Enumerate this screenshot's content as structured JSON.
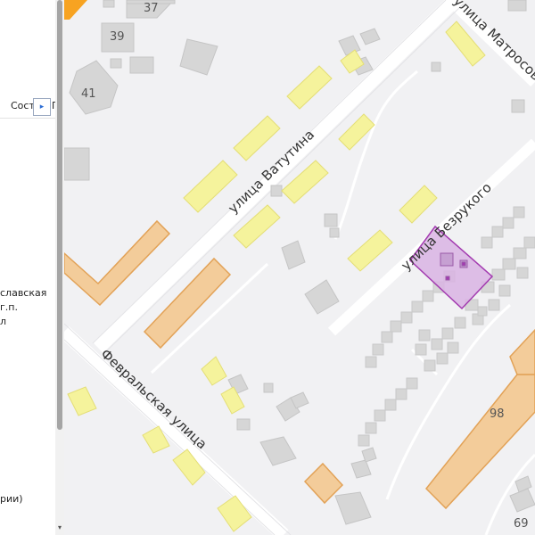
{
  "sidebar": {
    "tab_label": "Соста",
    "tab_cut": "Г",
    "collapse_arrow": "▸",
    "lines": [
      "славская",
      "г.п.",
      "л",
      "рии)"
    ],
    "scroll_down_arrow": "▾"
  },
  "map": {
    "streets": {
      "vatutina": "улица Ватутина",
      "bezrukogo": "улица Безрукого",
      "fevralskaya": "Февральская улица",
      "matrosova": "улица Матросова"
    },
    "house_numbers": [
      "37",
      "39",
      "41",
      "98",
      "69"
    ],
    "colors": {
      "background": "#f1f1f3",
      "road": "#ffffff",
      "residential": "#f5f39c",
      "commercial": "#f3cc9a",
      "commercial_border": "#e2a257",
      "building_gray": "#d6d6d6",
      "selection_fill": "#d9b4e3",
      "selection_border": "#a33bb0",
      "orange": "#f7a321"
    }
  }
}
